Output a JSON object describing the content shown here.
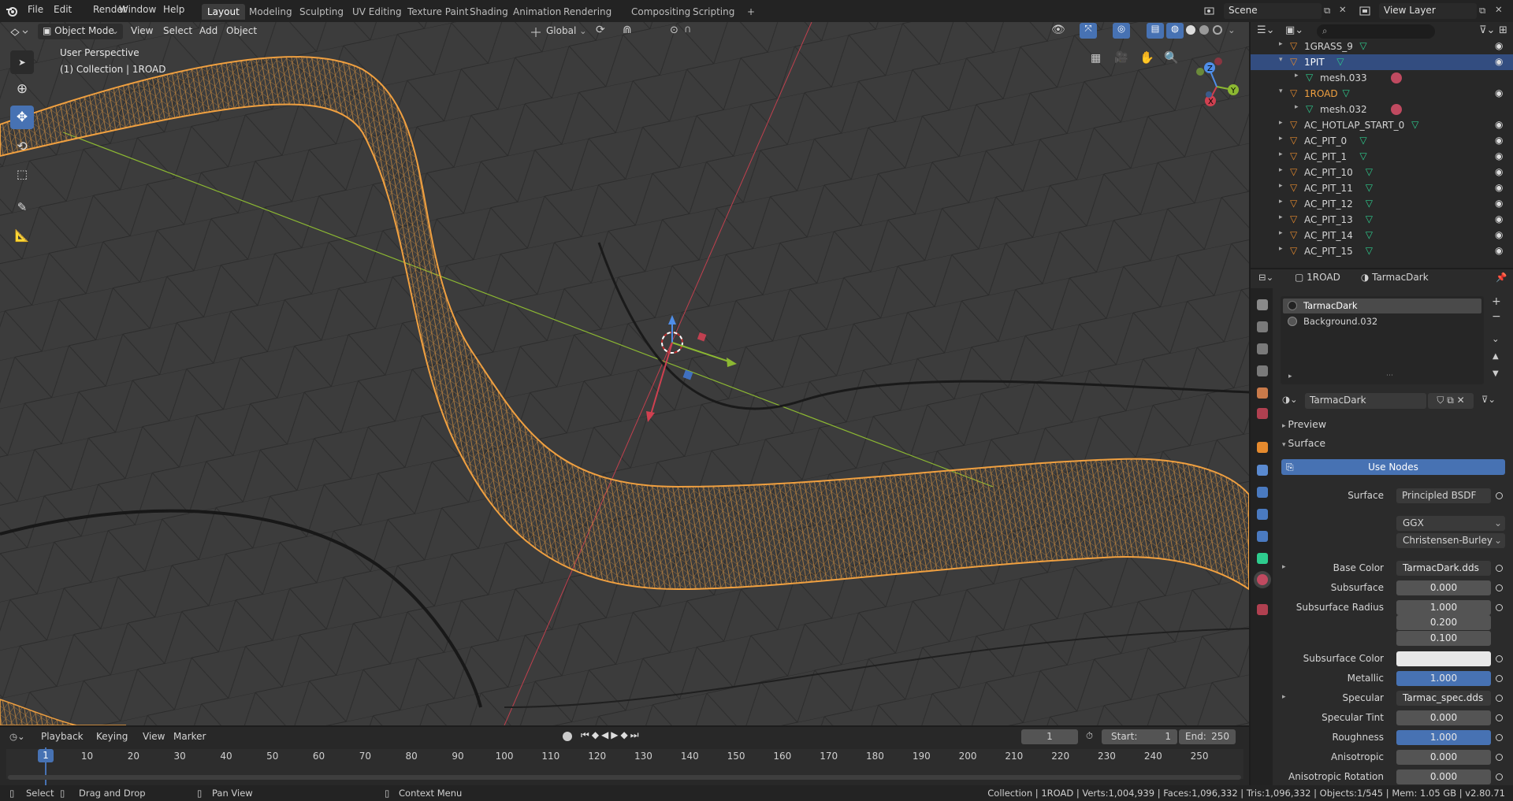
{
  "menu": [
    "File",
    "Edit",
    "Render",
    "Window",
    "Help"
  ],
  "workspaces": [
    "Layout",
    "Modeling",
    "Sculpting",
    "UV Editing",
    "Texture Paint",
    "Shading",
    "Animation",
    "Rendering",
    "Compositing",
    "Scripting",
    "+"
  ],
  "scene": "Scene",
  "view_layer": "View Layer",
  "viewport": {
    "mode": "Object Mode",
    "menus": [
      "View",
      "Select",
      "Add",
      "Object"
    ],
    "orientation": "Global",
    "perspective": "User Perspective",
    "collection_info": "(1) Collection | 1ROAD",
    "gizmo_axes": [
      "X",
      "Y",
      "Z"
    ],
    "colors": {
      "road": "#f0a040",
      "bg": "#3c3c3c",
      "x_axis": "#c0404e",
      "y_axis": "#8cb832",
      "selection_blue": "#4772b3"
    }
  },
  "outliner": {
    "rows": [
      {
        "label": "1GRASS_9",
        "indent": 1,
        "type": "object",
        "selected": false,
        "color": "#d4d4d4"
      },
      {
        "label": "1PIT",
        "indent": 1,
        "type": "object",
        "selected": true,
        "color": "#ffffff"
      },
      {
        "label": "mesh.033",
        "indent": 2,
        "type": "mesh",
        "selected": false,
        "color": "#d4d4d4"
      },
      {
        "label": "1ROAD",
        "indent": 1,
        "type": "object",
        "selected": false,
        "color": "#f0a040"
      },
      {
        "label": "mesh.032",
        "indent": 2,
        "type": "mesh",
        "selected": false,
        "color": "#d4d4d4"
      },
      {
        "label": "AC_HOTLAP_START_0",
        "indent": 1,
        "type": "object",
        "selected": false,
        "color": "#d4d4d4"
      },
      {
        "label": "AC_PIT_0",
        "indent": 1,
        "type": "object",
        "selected": false,
        "color": "#d4d4d4"
      },
      {
        "label": "AC_PIT_1",
        "indent": 1,
        "type": "object",
        "selected": false,
        "color": "#d4d4d4"
      },
      {
        "label": "AC_PIT_10",
        "indent": 1,
        "type": "object",
        "selected": false,
        "color": "#d4d4d4"
      },
      {
        "label": "AC_PIT_11",
        "indent": 1,
        "type": "object",
        "selected": false,
        "color": "#d4d4d4"
      },
      {
        "label": "AC_PIT_12",
        "indent": 1,
        "type": "object",
        "selected": false,
        "color": "#d4d4d4"
      },
      {
        "label": "AC_PIT_13",
        "indent": 1,
        "type": "object",
        "selected": false,
        "color": "#d4d4d4"
      },
      {
        "label": "AC_PIT_14",
        "indent": 1,
        "type": "object",
        "selected": false,
        "color": "#d4d4d4"
      },
      {
        "label": "AC_PIT_15",
        "indent": 1,
        "type": "object",
        "selected": false,
        "color": "#d4d4d4"
      }
    ]
  },
  "properties": {
    "object": "1ROAD",
    "material": "TarmacDark",
    "slots": [
      "TarmacDark",
      "Background.032"
    ],
    "material_name": "TarmacDark",
    "sections": {
      "preview": "Preview",
      "surface": "Surface"
    },
    "use_nodes": "Use Nodes",
    "surface_label": "Surface",
    "surface_shader": "Principled BSDF",
    "distribution": "GGX",
    "subsurface_method": "Christensen-Burley",
    "fields": [
      {
        "label": "Base Color",
        "value": "TarmacDark.dds",
        "style": "dark"
      },
      {
        "label": "Subsurface",
        "value": "0.000",
        "style": "num"
      },
      {
        "label": "Subsurface Radius",
        "value": "1.000",
        "style": "num"
      },
      {
        "label": "",
        "value": "0.200",
        "style": "num"
      },
      {
        "label": "",
        "value": "0.100",
        "style": "num"
      },
      {
        "label": "Subsurface Color",
        "value": "",
        "style": "color"
      },
      {
        "label": "Metallic",
        "value": "1.000",
        "style": "blue"
      },
      {
        "label": "Specular",
        "value": "Tarmac_spec.dds",
        "style": "dark"
      },
      {
        "label": "Specular Tint",
        "value": "0.000",
        "style": "num"
      },
      {
        "label": "Roughness",
        "value": "1.000",
        "style": "blue"
      },
      {
        "label": "Anisotropic",
        "value": "0.000",
        "style": "num"
      },
      {
        "label": "Anisotropic Rotation",
        "value": "0.000",
        "style": "num"
      }
    ]
  },
  "timeline": {
    "menus": [
      "Playback",
      "Keying",
      "View",
      "Marker"
    ],
    "current_frame": "1",
    "start_label": "Start:",
    "start": "1",
    "end_label": "End:",
    "end": "250",
    "ruler": [
      "1",
      "10",
      "20",
      "30",
      "40",
      "50",
      "60",
      "70",
      "80",
      "90",
      "100",
      "110",
      "120",
      "130",
      "140",
      "150",
      "160",
      "170",
      "180",
      "190",
      "200",
      "210",
      "220",
      "230",
      "240",
      "250"
    ]
  },
  "status": {
    "select": "Select",
    "drag": "Drag and Drop",
    "pan": "Pan View",
    "context": "Context Menu",
    "stats": "Collection | 1ROAD | Verts:1,004,939 | Faces:1,096,332 | Tris:1,096,332 | Objects:1/545 | Mem: 1.05 GB | v2.80.71"
  }
}
